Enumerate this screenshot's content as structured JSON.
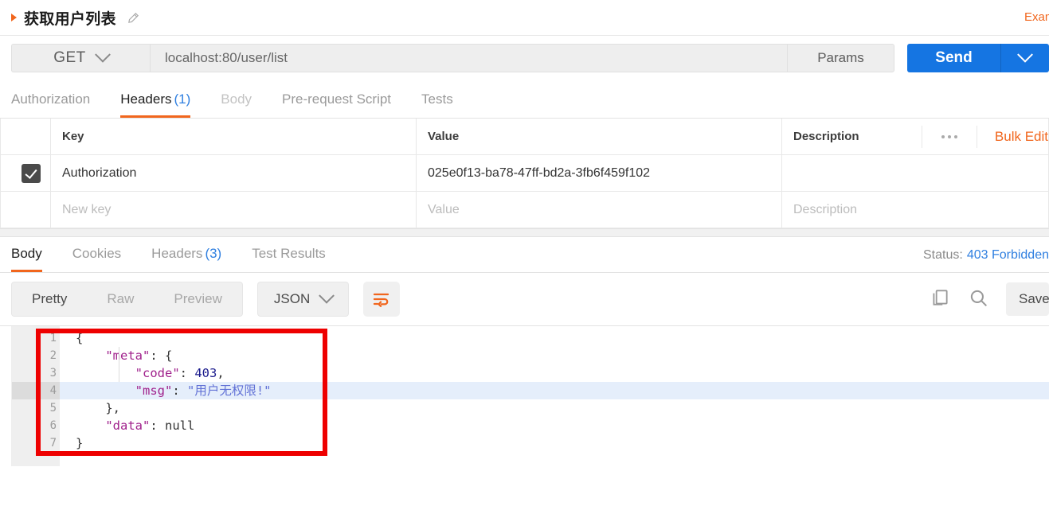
{
  "request": {
    "title": "获取用户列表",
    "edit_icon": "pencil-icon",
    "examples_link": "Examples",
    "method": "GET",
    "url": "localhost:80/user/list",
    "params_label": "Params",
    "send_label": "Send"
  },
  "request_tabs": [
    {
      "label": "Authorization",
      "count": "",
      "state": "normal"
    },
    {
      "label": "Headers",
      "count": "(1)",
      "state": "active"
    },
    {
      "label": "Body",
      "count": "",
      "state": "dim"
    },
    {
      "label": "Pre-request Script",
      "count": "",
      "state": "normal"
    },
    {
      "label": "Tests",
      "count": "",
      "state": "normal"
    }
  ],
  "headers_table": {
    "columns": [
      "Key",
      "Value",
      "Description"
    ],
    "bulk_edit_label": "Bulk Edit",
    "rows": [
      {
        "checked": true,
        "key": "Authorization",
        "value": "025e0f13-ba78-47ff-bd2a-3fb6f459f102",
        "description": ""
      }
    ],
    "new_row": {
      "key_placeholder": "New key",
      "value_placeholder": "Value",
      "description_placeholder": "Description"
    }
  },
  "response_tabs": [
    {
      "label": "Body",
      "count": "",
      "state": "active"
    },
    {
      "label": "Cookies",
      "count": "",
      "state": "normal"
    },
    {
      "label": "Headers",
      "count": "(3)",
      "state": "normal"
    },
    {
      "label": "Test Results",
      "count": "",
      "state": "normal"
    }
  ],
  "status": {
    "label": "Status:",
    "value": "403 Forbidden",
    "color": "#2f7fe0"
  },
  "response_toolbar": {
    "view_modes": [
      "Pretty",
      "Raw",
      "Preview"
    ],
    "active_view": "Pretty",
    "format": "JSON",
    "wrap_icon": "word-wrap-icon",
    "copy_icon": "copy-icon",
    "search_icon": "search-icon",
    "save_label": "Save Response"
  },
  "response_body": {
    "line_numbers": [
      "1",
      "2",
      "3",
      "4",
      "5",
      "6",
      "7"
    ],
    "highlighted_line": 4,
    "lines": [
      [
        {
          "t": "{",
          "c": "pun"
        }
      ],
      [
        {
          "t": "    ",
          "c": "pun"
        },
        {
          "t": "\"meta\"",
          "c": "key"
        },
        {
          "t": ": {",
          "c": "pun"
        }
      ],
      [
        {
          "t": "        ",
          "c": "pun"
        },
        {
          "t": "\"code\"",
          "c": "key"
        },
        {
          "t": ": ",
          "c": "pun"
        },
        {
          "t": "403",
          "c": "num"
        },
        {
          "t": ",",
          "c": "pun"
        }
      ],
      [
        {
          "t": "        ",
          "c": "pun"
        },
        {
          "t": "\"msg\"",
          "c": "key"
        },
        {
          "t": ": ",
          "c": "pun"
        },
        {
          "t": "\"用户无权限!\"",
          "c": "str"
        }
      ],
      [
        {
          "t": "    },",
          "c": "pun"
        }
      ],
      [
        {
          "t": "    ",
          "c": "pun"
        },
        {
          "t": "\"data\"",
          "c": "key"
        },
        {
          "t": ": ",
          "c": "pun"
        },
        {
          "t": "null",
          "c": "null"
        }
      ],
      [
        {
          "t": "}",
          "c": "pun"
        }
      ]
    ],
    "annotation": {
      "shape": "rectangle",
      "color": "#ee0000"
    }
  },
  "colors": {
    "accent_orange": "#f1661d",
    "send_blue": "#1575e2",
    "link_blue": "#2f7fe0",
    "annotation_red": "#ee0000"
  }
}
